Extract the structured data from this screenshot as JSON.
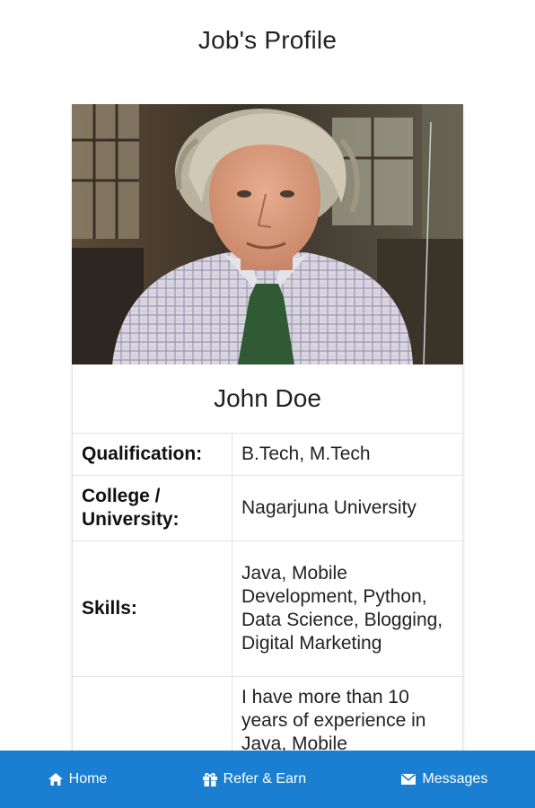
{
  "header": {
    "title": "Job's Profile"
  },
  "profile": {
    "name": "John Doe",
    "photo_icon": "portrait-photo",
    "details": [
      {
        "label": "Qualification:",
        "value": "B.Tech, M.Tech"
      },
      {
        "label": "College / University:",
        "value": "Nagarjuna University"
      },
      {
        "label": "Skills:",
        "value": "Java, Mobile Development, Python, Data Science, Blogging, Digital Marketing"
      },
      {
        "label": "",
        "value": "I have more than 10 years of experience in Java, Mobile"
      }
    ]
  },
  "bottom_nav": {
    "background": "#1a7fd0",
    "items": [
      {
        "label": "Home",
        "icon": "home-icon"
      },
      {
        "label": "Refer & Earn",
        "icon": "gift-icon"
      },
      {
        "label": "Messages",
        "icon": "envelope-icon"
      }
    ]
  }
}
